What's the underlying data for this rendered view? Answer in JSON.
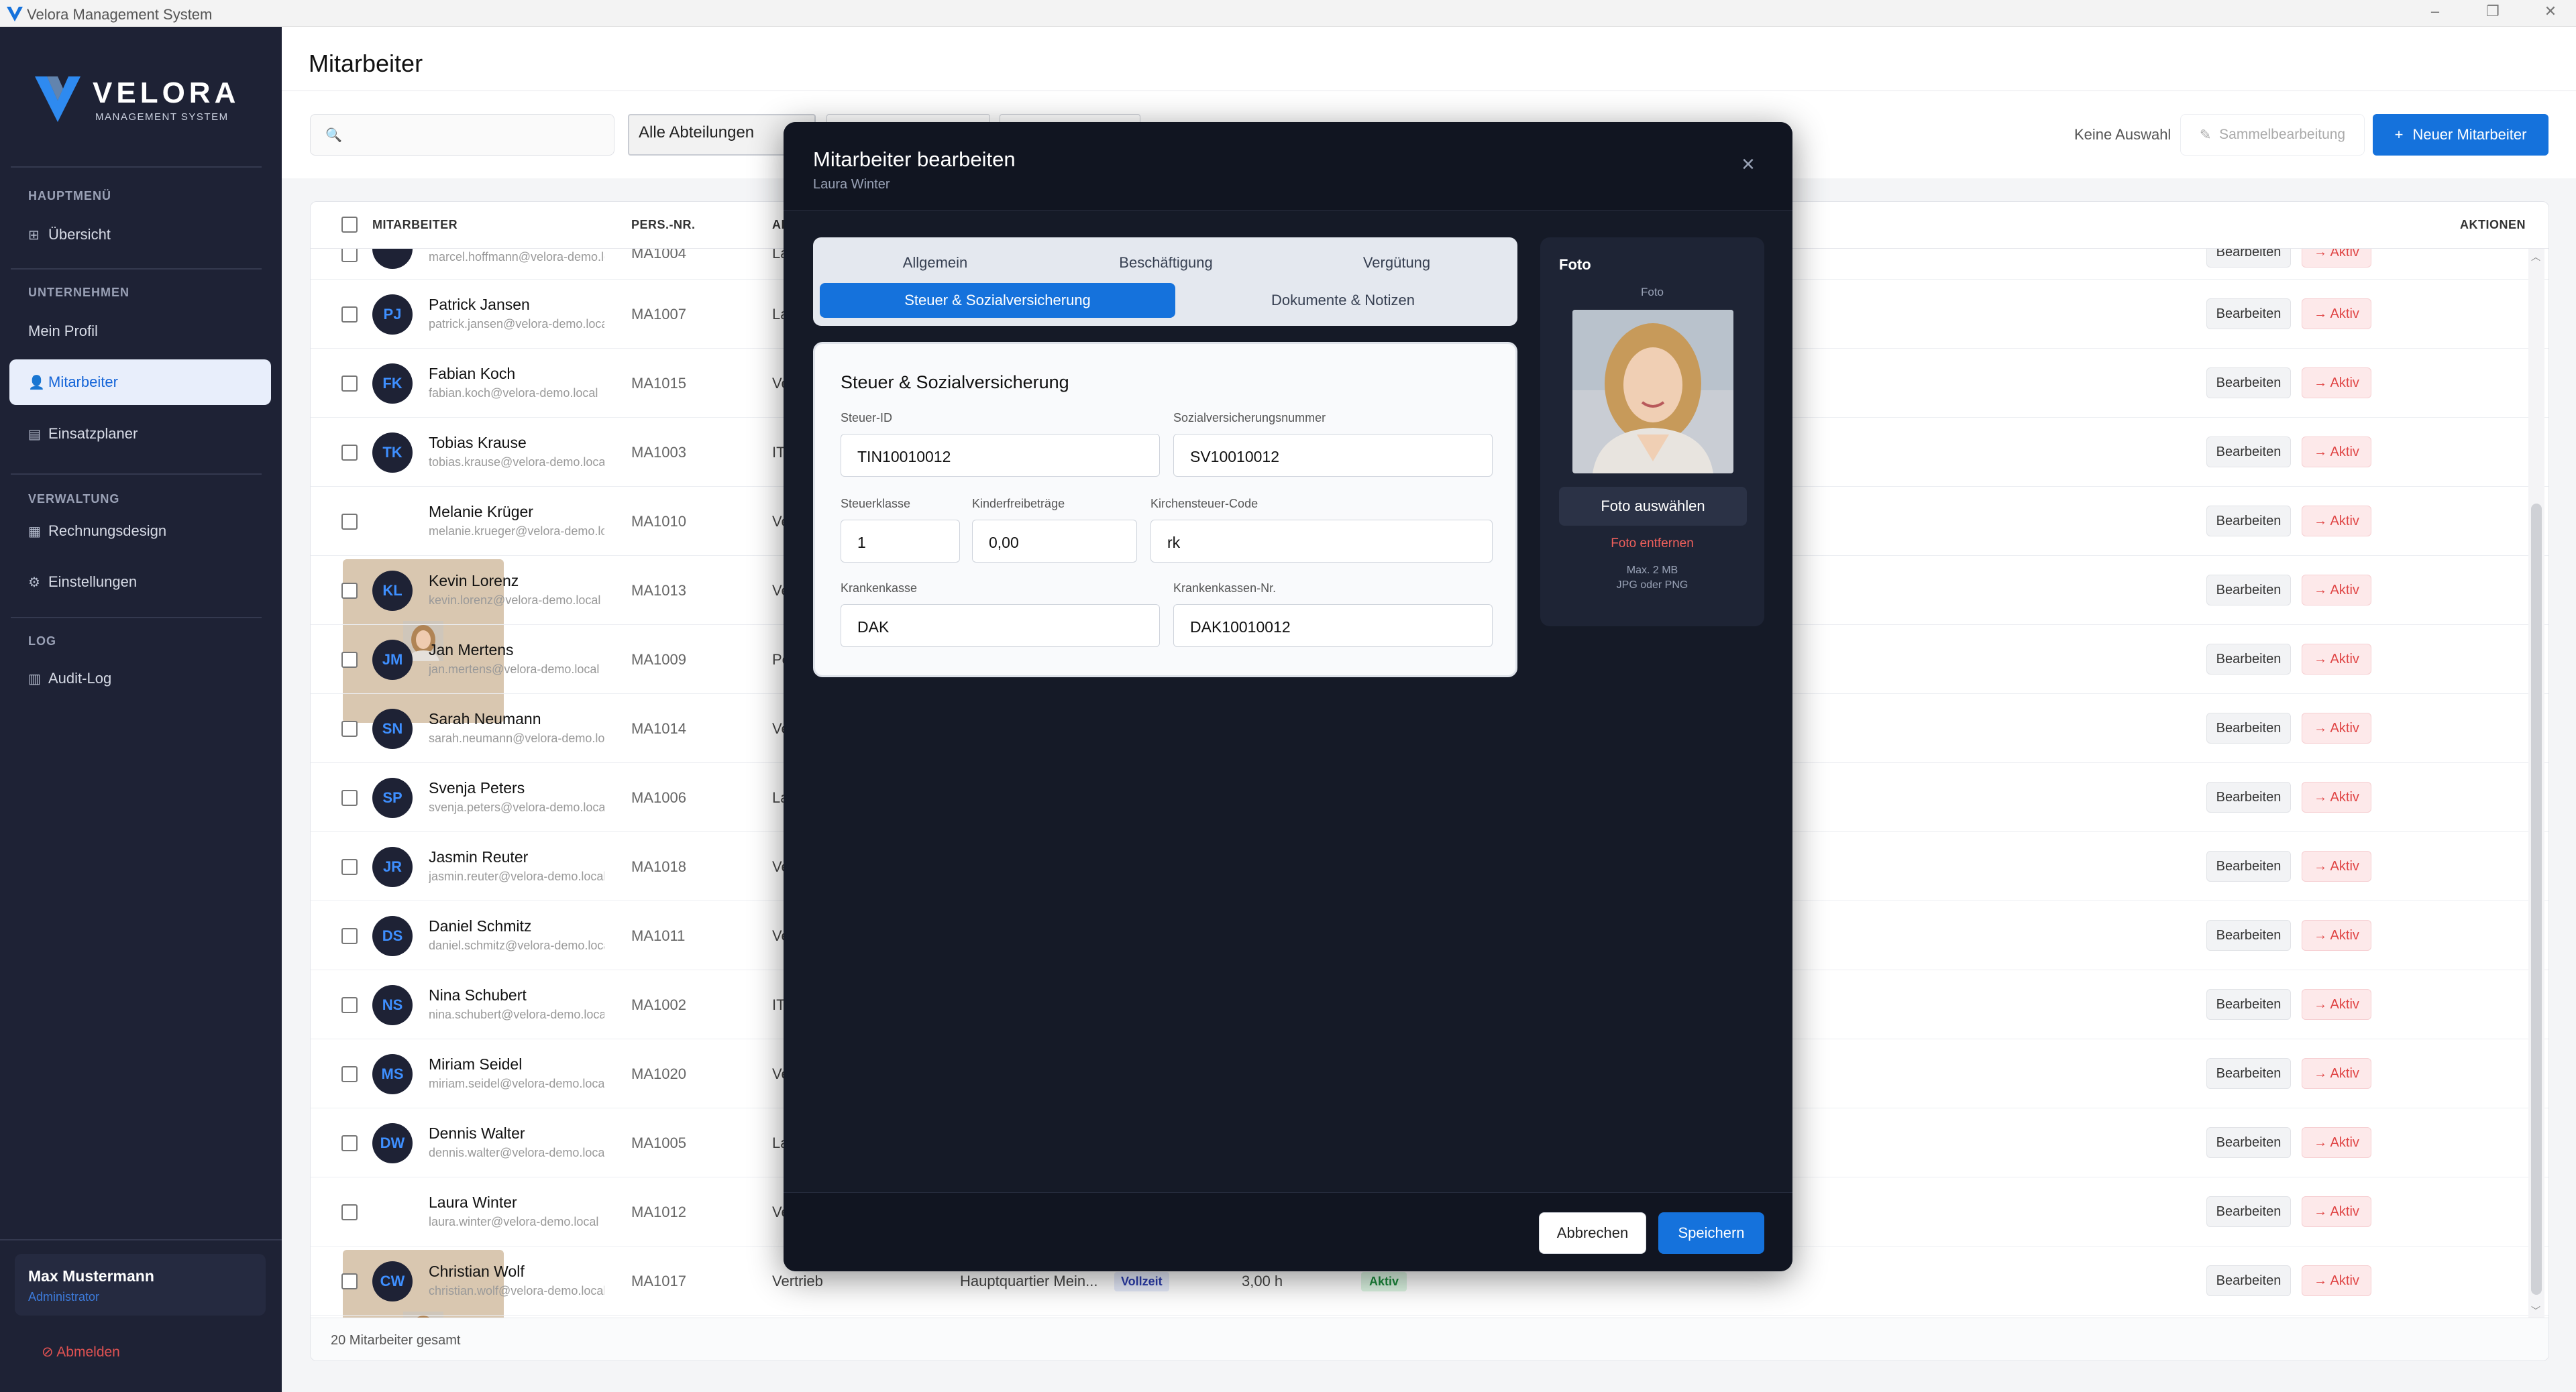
{
  "window": {
    "title": "Velora Management System"
  },
  "brand": {
    "name": "VELORA",
    "tagline": "MANAGEMENT SYSTEM"
  },
  "sidebar": {
    "sections": [
      "HAUPTMENÜ",
      "UNTERNEHMEN",
      "VERWALTUNG",
      "LOG"
    ],
    "items": [
      {
        "label": "Übersicht",
        "icon": "grid-icon"
      },
      {
        "label": "Mein Profil",
        "icon": ""
      },
      {
        "label": "Mitarbeiter",
        "icon": "user-icon",
        "active": true
      },
      {
        "label": "Einsatzplaner",
        "icon": "calendar-icon"
      },
      {
        "label": "Rechnungsdesign",
        "icon": "document-icon"
      },
      {
        "label": "Einstellungen",
        "icon": "gear-icon"
      },
      {
        "label": "Audit-Log",
        "icon": "log-icon"
      }
    ],
    "user": {
      "name": "Max Mustermann",
      "role": "Administrator"
    },
    "logout": "Abmelden"
  },
  "page": {
    "title": "Mitarbeiter"
  },
  "toolbar": {
    "search_placeholder": "",
    "department_filter": "Alle Abteilungen",
    "selection_text": "Keine Auswahl",
    "bulk_edit": "Sammelbearbeitung",
    "new_employee": "Neuer Mitarbeiter"
  },
  "table": {
    "headers": {
      "employee": "MITARBEITER",
      "personnel_no": "PERS.-NR.",
      "dept_partial": "AI",
      "actions": "AKTIONEN"
    },
    "partial_row": {
      "email": "marcel.hoffmann@velora-demo.loc",
      "personnel_no": "MA1004",
      "dept": "La"
    },
    "rows": [
      {
        "initials": "PJ",
        "name": "Patrick Jansen",
        "email": "patrick.jansen@velora-demo.local",
        "personnel_no": "MA1007",
        "dept": "La"
      },
      {
        "initials": "FK",
        "name": "Fabian Koch",
        "email": "fabian.koch@velora-demo.local",
        "personnel_no": "MA1015",
        "dept": "Ve"
      },
      {
        "initials": "TK",
        "name": "Tobias Krause",
        "email": "tobias.krause@velora-demo.local",
        "personnel_no": "MA1003",
        "dept": "IT"
      },
      {
        "initials": "",
        "photo": true,
        "name": "Melanie Krüger",
        "email": "melanie.krueger@velora-demo.loca",
        "personnel_no": "MA1010",
        "dept": "Ve"
      },
      {
        "initials": "KL",
        "name": "Kevin Lorenz",
        "email": "kevin.lorenz@velora-demo.local",
        "personnel_no": "MA1013",
        "dept": "Ve"
      },
      {
        "initials": "JM",
        "name": "Jan Mertens",
        "email": "jan.mertens@velora-demo.local",
        "personnel_no": "MA1009",
        "dept": "Pe"
      },
      {
        "initials": "SN",
        "name": "Sarah Neumann",
        "email": "sarah.neumann@velora-demo.local",
        "personnel_no": "MA1014",
        "dept": "Ve"
      },
      {
        "initials": "SP",
        "name": "Svenja Peters",
        "email": "svenja.peters@velora-demo.local",
        "personnel_no": "MA1006",
        "dept": "La"
      },
      {
        "initials": "JR",
        "name": "Jasmin Reuter",
        "email": "jasmin.reuter@velora-demo.local",
        "personnel_no": "MA1018",
        "dept": "Ve"
      },
      {
        "initials": "DS",
        "name": "Daniel Schmitz",
        "email": "daniel.schmitz@velora-demo.local",
        "personnel_no": "MA1011",
        "dept": "Ve"
      },
      {
        "initials": "NS",
        "name": "Nina Schubert",
        "email": "nina.schubert@velora-demo.local",
        "personnel_no": "MA1002",
        "dept": "IT"
      },
      {
        "initials": "MS",
        "name": "Miriam Seidel",
        "email": "miriam.seidel@velora-demo.local",
        "personnel_no": "MA1020",
        "dept": "Ve"
      },
      {
        "initials": "DW",
        "name": "Dennis Walter",
        "email": "dennis.walter@velora-demo.local",
        "personnel_no": "MA1005",
        "dept": "La"
      },
      {
        "initials": "",
        "photo": true,
        "name": "Laura Winter",
        "email": "laura.winter@velora-demo.local",
        "personnel_no": "MA1012",
        "dept": "Ve"
      },
      {
        "initials": "CW",
        "name": "Christian Wolf",
        "email": "christian.wolf@velora-demo.local",
        "personnel_no": "MA1017",
        "dept": "Vertrieb",
        "location": "Hauptquartier Mein...",
        "type": "Vollzeit",
        "hours": "3,00 h",
        "status": "Aktiv"
      }
    ],
    "edit_label": "Bearbeiten",
    "active_label": "→ Aktiv",
    "footer": "20 Mitarbeiter gesamt"
  },
  "modal": {
    "title": "Mitarbeiter bearbeiten",
    "subtitle": "Laura Winter",
    "tabs": [
      "Allgemein",
      "Beschäftigung",
      "Vergütung",
      "Steuer & Sozialversicherung",
      "Dokumente & Notizen"
    ],
    "active_tab": "Steuer & Sozialversicherung",
    "section_title": "Steuer & Sozialversicherung",
    "fields": {
      "tax_id": {
        "label": "Steuer-ID",
        "value": "TIN10010012"
      },
      "ssn": {
        "label": "Sozialversicherungsnummer",
        "value": "SV10010012"
      },
      "tax_class": {
        "label": "Steuerklasse",
        "value": "1"
      },
      "child_allowance": {
        "label": "Kinderfreibeträge",
        "value": "0,00"
      },
      "church_tax": {
        "label": "Kirchensteuer-Code",
        "value": "rk"
      },
      "insurance": {
        "label": "Krankenkasse",
        "value": "DAK"
      },
      "insurance_no": {
        "label": "Krankenkassen-Nr.",
        "value": "DAK10010012"
      }
    },
    "photo": {
      "heading": "Foto",
      "caption": "Foto",
      "select": "Foto auswählen",
      "remove": "Foto entfernen",
      "hint1": "Max. 2 MB",
      "hint2": "JPG oder PNG"
    },
    "cancel": "Abbrechen",
    "save": "Speichern"
  },
  "colors": {
    "accent": "#1572dc",
    "sidebar": "#1e2235",
    "modal": "#151a27",
    "danger": "#e04545"
  }
}
